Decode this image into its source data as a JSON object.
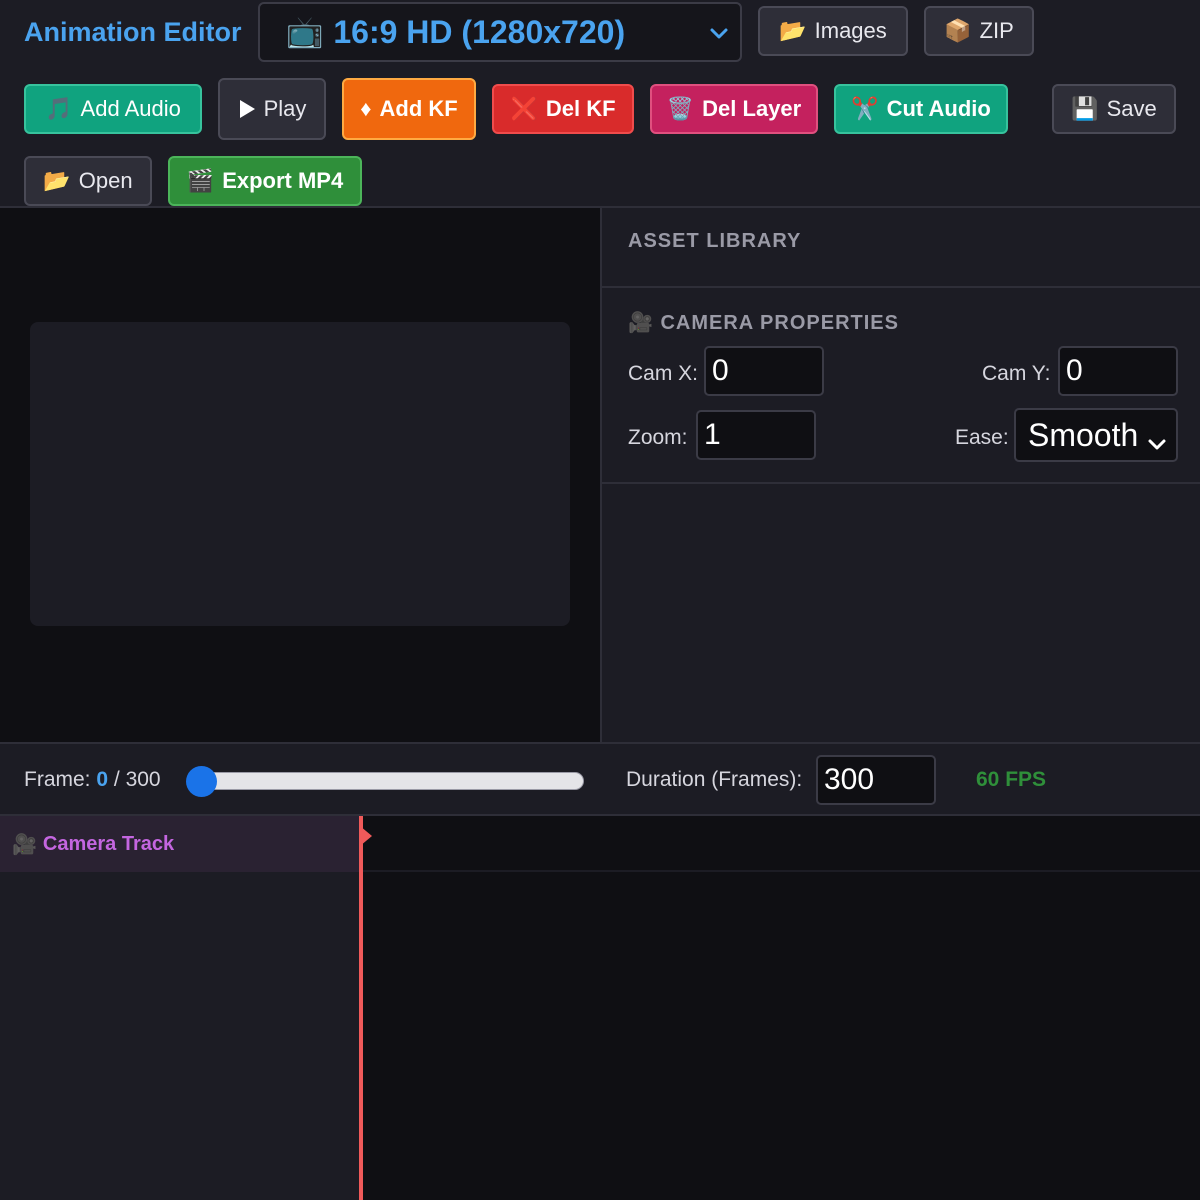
{
  "toolbar": {
    "title": "Animation Editor",
    "preset": {
      "emoji": "📺",
      "value": "16:9 HD (1280x720)"
    },
    "buttons": {
      "images": {
        "emoji": "📂",
        "label": "Images"
      },
      "zip": {
        "emoji": "📦",
        "label": "ZIP"
      },
      "add_audio": {
        "emoji": "🎵",
        "label": "Add Audio"
      },
      "play": {
        "label": "Play"
      },
      "add_kf": {
        "emoji": "♦",
        "label": "Add KF"
      },
      "del_kf": {
        "emoji": "❌",
        "label": "Del KF"
      },
      "del_layer": {
        "emoji": "🗑️",
        "label": "Del Layer"
      },
      "cut_audio": {
        "emoji": "✂️",
        "label": "Cut Audio"
      },
      "save": {
        "emoji": "💾",
        "label": "Save"
      },
      "open": {
        "emoji": "📂",
        "label": "Open"
      },
      "export": {
        "emoji": "🎬",
        "label": "Export MP4"
      }
    }
  },
  "asset_library": {
    "heading": "ASSET LIBRARY"
  },
  "camera": {
    "heading_emoji": "🎥",
    "heading": "CAMERA PROPERTIES",
    "cam_x_label": "Cam X:",
    "cam_x": "0",
    "cam_y_label": "Cam Y:",
    "cam_y": "0",
    "zoom_label": "Zoom:",
    "zoom": "1",
    "ease_label": "Ease:",
    "ease": "Smooth"
  },
  "timeline": {
    "frame_label": "Frame:",
    "current_frame": "0",
    "separator": "/",
    "total_frames": "300",
    "slider_value": 0,
    "duration_label": "Duration (Frames):",
    "duration": "300",
    "fps": "60 FPS"
  },
  "tracks": [
    {
      "emoji": "🎥",
      "name": "Camera Track"
    }
  ],
  "colors": {
    "accent": "#4aa3ef",
    "playhead": "#f05a5a",
    "track_name": "#c466e0",
    "fps": "#2f8f3a"
  }
}
